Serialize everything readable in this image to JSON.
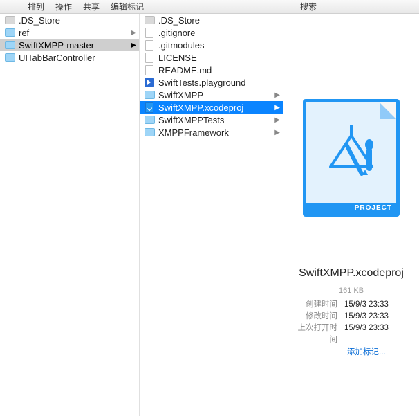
{
  "toolbar": {
    "menu": [
      "排列",
      "操作",
      "共享",
      "编辑标记"
    ],
    "search_label": "搜索"
  },
  "col1": [
    {
      "icon": "folder-gray",
      "name": ".DS_Store",
      "hasChildren": false
    },
    {
      "icon": "folder",
      "name": "ref",
      "hasChildren": true
    },
    {
      "icon": "folder",
      "name": "SwiftXMPP-master",
      "hasChildren": true,
      "selected": true
    },
    {
      "icon": "folder",
      "name": "UITabBarController",
      "hasChildren": false
    }
  ],
  "col2": [
    {
      "icon": "folder-gray",
      "name": ".DS_Store",
      "hasChildren": false
    },
    {
      "icon": "doc",
      "name": ".gitignore",
      "hasChildren": false
    },
    {
      "icon": "doc",
      "name": ".gitmodules",
      "hasChildren": false
    },
    {
      "icon": "doc",
      "name": "LICENSE",
      "hasChildren": false
    },
    {
      "icon": "doc",
      "name": "README.md",
      "hasChildren": false
    },
    {
      "icon": "playground",
      "name": "SwiftTests.playground",
      "hasChildren": false
    },
    {
      "icon": "folder",
      "name": "SwiftXMPP",
      "hasChildren": true
    },
    {
      "icon": "xcodeproj",
      "name": "SwiftXMPP.xcodeproj",
      "hasChildren": true,
      "selectedActive": true
    },
    {
      "icon": "folder",
      "name": "SwiftXMPPTests",
      "hasChildren": true
    },
    {
      "icon": "folder",
      "name": "XMPPFramework",
      "hasChildren": true
    }
  ],
  "preview": {
    "banner": "PROJECT",
    "filename": "SwiftXMPP.xcodeproj",
    "size": "161 KB",
    "meta": [
      {
        "k": "创建时间",
        "v": "15/9/3 23:33"
      },
      {
        "k": "修改时间",
        "v": "15/9/3 23:33"
      },
      {
        "k": "上次打开时间",
        "v": "15/9/3 23:33"
      }
    ],
    "add_tag": "添加标记..."
  }
}
